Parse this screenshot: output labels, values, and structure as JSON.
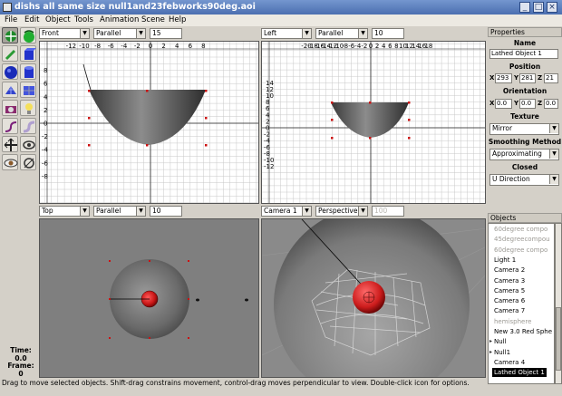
{
  "window": {
    "title": "dishs all same size null1and23febworks90deg.aoi",
    "controls": [
      "_",
      "□",
      "×"
    ]
  },
  "menu": [
    "File",
    "Edit",
    "Object",
    "Tools",
    "Animation",
    "Scene",
    "Help"
  ],
  "tools": [
    "move-tool",
    "rotate-tool",
    "brush-tool",
    "cube-tool",
    "sphere-tool",
    "cylinder-tool",
    "polymesh-tool",
    "spline-tool",
    "camera-tool",
    "light-tool",
    "curve-tool",
    "tube-tool",
    "pan-tool",
    "view-rotate-tool"
  ],
  "viewports": {
    "front": {
      "view": "Front",
      "projection": "Parallel",
      "scale": "15",
      "xticks": [
        "-12",
        "-10",
        "-8",
        "-6",
        "-4",
        "-2",
        "0",
        "2",
        "4",
        "6",
        "8"
      ],
      "yticks": [
        "8",
        "6",
        "4",
        "2",
        "0",
        "-2",
        "-4",
        "-6",
        "-8"
      ]
    },
    "left": {
      "view": "Left",
      "projection": "Parallel",
      "scale": "10",
      "xticks": [
        "-20",
        "-18",
        "-16",
        "-14",
        "-12",
        "-10",
        "-8",
        "-6",
        "-4",
        "-2",
        "0",
        "2",
        "4",
        "6",
        "8",
        "10",
        "12",
        "14",
        "16",
        "18"
      ],
      "yticks": [
        "14",
        "12",
        "10",
        "8",
        "6",
        "4",
        "2",
        "0",
        "-2",
        "-4",
        "-6",
        "-8",
        "-10",
        "-12"
      ]
    },
    "top": {
      "view": "Top",
      "projection": "Parallel",
      "scale": "10"
    },
    "camera": {
      "view": "Camera 1",
      "projection": "Perspective",
      "scale": "100"
    }
  },
  "properties": {
    "panel_title": "Properties",
    "name_label": "Name",
    "name_value": "Lathed Object 1",
    "position_label": "Position",
    "position": {
      "x_label": "X",
      "x": "293",
      "y_label": "Y",
      "y": "281",
      "z_label": "Z",
      "z": "21"
    },
    "orientation_label": "Orientation",
    "orientation": {
      "x_label": "X",
      "x": "0.0",
      "y_label": "Y",
      "y": "0.0",
      "z_label": "Z",
      "z": "0.0"
    },
    "texture_label": "Texture",
    "texture_value": "Mirror",
    "smoothing_label": "Smoothing Method",
    "smoothing_value": "Approximating",
    "closed_label": "Closed",
    "closed_value": "U Direction"
  },
  "objects": {
    "panel_title": "Objects",
    "items": [
      {
        "label": "60degree compo",
        "dim": true
      },
      {
        "label": "45degreecompou",
        "dim": true
      },
      {
        "label": "60degree compo",
        "dim": true
      },
      {
        "label": "Light 1"
      },
      {
        "label": "Camera 2"
      },
      {
        "label": "Camera 3"
      },
      {
        "label": "Camera 5"
      },
      {
        "label": "Camera 6"
      },
      {
        "label": "Camera 7"
      },
      {
        "label": "hemisphere",
        "dim": true
      },
      {
        "label": "New 3.0 Red Sphe"
      },
      {
        "label": "Null",
        "expander": true
      },
      {
        "label": "Null1",
        "expander": true
      },
      {
        "label": "Camera 4"
      },
      {
        "label": "Lathed Object 1",
        "selected": true
      }
    ]
  },
  "time": {
    "time_label": "Time:",
    "time_value": "0.0",
    "frame_label": "Frame:",
    "frame_value": "0"
  },
  "status": "Drag to move selected objects.  Shift-drag constrains movement, control-drag moves perpendicular to view.  Double-click icon for options.",
  "colors": {
    "titlebar": "#4b6fb0",
    "handle": "#cc1111",
    "sphere_red": "#d62020"
  }
}
